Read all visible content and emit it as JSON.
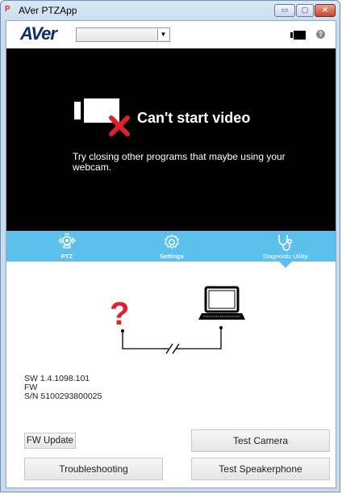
{
  "window": {
    "title": "AVer PTZApp",
    "app_icon_text": "P",
    "controls": {
      "minimize_glyph": "▭",
      "maximize_glyph": "▢",
      "close_glyph": "✕"
    }
  },
  "toolbar": {
    "logo": "AVer",
    "camera_select": {
      "value": "",
      "arrow": "▼"
    },
    "help_glyph": "?"
  },
  "video": {
    "error_title": "Can't start video",
    "error_message": "Try closing other programs that maybe using your webcam."
  },
  "nav": {
    "tabs": [
      {
        "label": "PTZ",
        "icon": "ptz-camera-icon"
      },
      {
        "label": "Settings",
        "icon": "gear-icon"
      },
      {
        "label": "Diagnostic Utility",
        "icon": "stethoscope-icon"
      }
    ],
    "active_tab": "Diagnostic Utility"
  },
  "diagnostic": {
    "unknown_device_glyph": "?",
    "link_status": "broken"
  },
  "device_info": {
    "sw": "SW 1.4.1098.101",
    "fw": "FW",
    "sn": "S/N 5100293800025"
  },
  "buttons": {
    "fw_update": "FW Update",
    "test_camera": "Test Camera",
    "troubleshooting": "Troubleshooting",
    "test_speakerphone": "Test Speakerphone"
  },
  "colors": {
    "nav_bar": "#5bc0eb",
    "error_red": "#e0202a",
    "video_bg": "#000000"
  }
}
